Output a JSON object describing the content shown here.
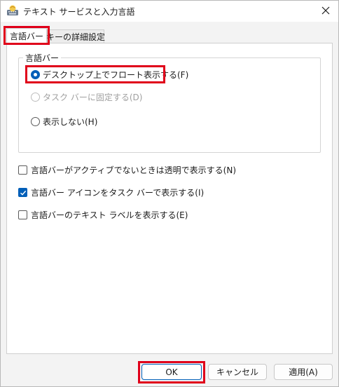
{
  "window": {
    "title": "テキスト サービスと入力言語",
    "app_icon": "language-keyboard-icon",
    "close_icon": "close-icon"
  },
  "tabs": [
    {
      "label": "言語バー",
      "selected": true
    },
    {
      "label": "キーの詳細設定",
      "selected": false
    }
  ],
  "language_bar": {
    "group_label": "言語バー",
    "options": [
      {
        "label": "デスクトップ上でフロート表示する(F)",
        "selected": true,
        "enabled": true
      },
      {
        "label": "タスク バーに固定する(D)",
        "selected": false,
        "enabled": false
      },
      {
        "label": "表示しない(H)",
        "selected": false,
        "enabled": true
      }
    ],
    "checkboxes": [
      {
        "label": "言語バーがアクティブでないときは透明で表示する(N)",
        "checked": false
      },
      {
        "label": "言語バー アイコンをタスク バーで表示する(I)",
        "checked": true
      },
      {
        "label": "言語バーのテキスト ラベルを表示する(E)",
        "checked": false
      }
    ]
  },
  "buttons": {
    "ok": "OK",
    "cancel": "キャンセル",
    "apply": "適用(A)"
  },
  "colors": {
    "highlight": "#e0001a",
    "accent": "#005fb8"
  }
}
